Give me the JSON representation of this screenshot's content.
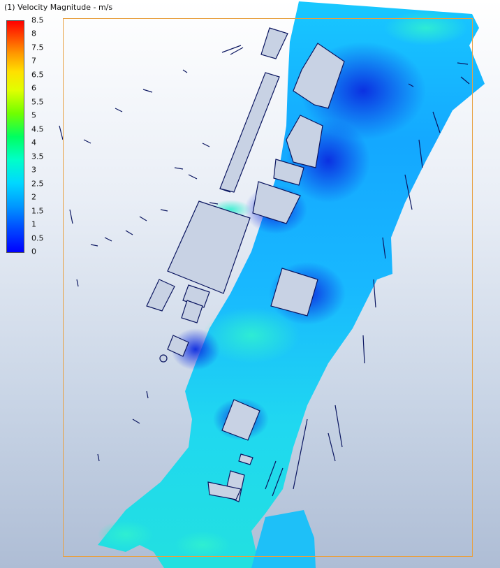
{
  "legend": {
    "title": "(1) Velocity Magnitude - m/s",
    "ticks": [
      "8.5",
      "8",
      "7.5",
      "7",
      "6.5",
      "6",
      "5.5",
      "5",
      "4.5",
      "4",
      "3.5",
      "3",
      "2.5",
      "2",
      "1.5",
      "1",
      "0.5",
      "0"
    ],
    "tick_values": [
      8.5,
      8,
      7.5,
      7,
      6.5,
      6,
      5.5,
      5,
      4.5,
      4,
      3.5,
      3,
      2.5,
      2,
      1.5,
      1,
      0.5,
      0
    ],
    "min": 0,
    "max": 8.5,
    "colormap": [
      "#0000ff",
      "#0066ff",
      "#00c0ff",
      "#00ffcc",
      "#00ff66",
      "#66ff00",
      "#ccff00",
      "#ffff00",
      "#ffcc00",
      "#ff8800",
      "#ff3300",
      "#ff0000"
    ]
  },
  "colors": {
    "frame": "#e8a040",
    "building_fill": "#c8d2e4",
    "building_stroke": "#0b1660",
    "flow_low": "#0a30e8",
    "flow_mid": "#1aa8ff",
    "flow_high": "#22e6e0"
  }
}
